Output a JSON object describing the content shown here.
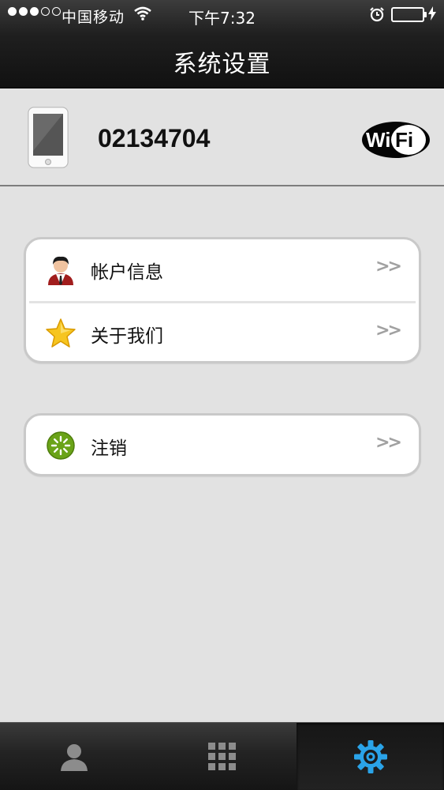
{
  "status_bar": {
    "carrier": "中国移动",
    "time": "下午7:32",
    "signal_bars": 3,
    "signal_total": 5,
    "battery_level": 1.0,
    "battery_color": "#46d94a"
  },
  "nav": {
    "title": "系统设置"
  },
  "device": {
    "id": "02134704",
    "icon": "phone-icon",
    "wifi_logo": "WiFi"
  },
  "groups": [
    {
      "rows": [
        {
          "label": "帐户信息",
          "icon": "user-avatar-icon",
          "chevron": ">>"
        },
        {
          "label": "关于我们",
          "icon": "star-icon",
          "chevron": ">>"
        }
      ]
    },
    {
      "rows": [
        {
          "label": "注销",
          "icon": "power-loading-icon",
          "chevron": ">>"
        }
      ]
    }
  ],
  "tab_bar": {
    "tabs": [
      {
        "icon": "person-icon",
        "active": false
      },
      {
        "icon": "grid-icon",
        "active": false
      },
      {
        "icon": "gear-icon",
        "active": true
      }
    ],
    "active_color": "#2aa3e8"
  }
}
